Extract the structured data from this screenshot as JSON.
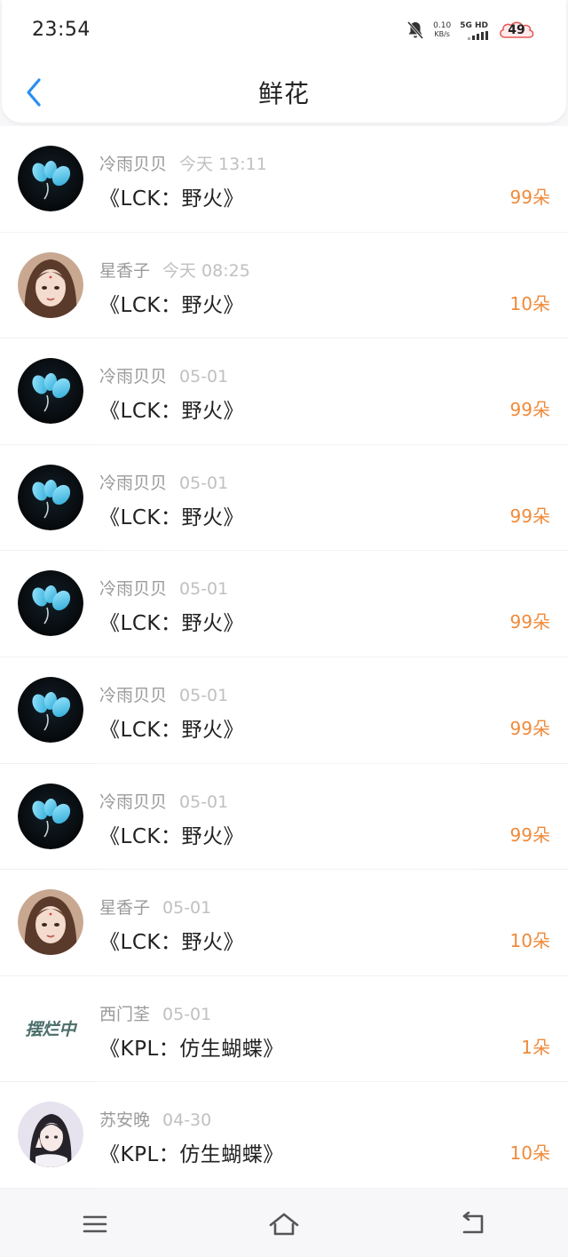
{
  "status_bar": {
    "time": "23:54",
    "net_speed_value": "0.10",
    "net_speed_unit": "KB/s",
    "network_label": "5G HD",
    "battery": "49"
  },
  "nav": {
    "title": "鲜花",
    "back_icon": "chevron-left-icon"
  },
  "colors": {
    "accent_blue": "#2a8ff0",
    "count_orange": "#f08a3a"
  },
  "items": [
    {
      "name": "冷雨贝贝",
      "date": "今天 13:11",
      "title": "《LCK：野火》",
      "count": "99朵",
      "avatar": "blue-butterfly"
    },
    {
      "name": "星香子",
      "date": "今天 08:25",
      "title": "《LCK：野火》",
      "count": "10朵",
      "avatar": "girl-portrait"
    },
    {
      "name": "冷雨贝贝",
      "date": "05-01",
      "title": "《LCK：野火》",
      "count": "99朵",
      "avatar": "blue-butterfly"
    },
    {
      "name": "冷雨贝贝",
      "date": "05-01",
      "title": "《LCK：野火》",
      "count": "99朵",
      "avatar": "blue-butterfly"
    },
    {
      "name": "冷雨贝贝",
      "date": "05-01",
      "title": "《LCK：野火》",
      "count": "99朵",
      "avatar": "blue-butterfly"
    },
    {
      "name": "冷雨贝贝",
      "date": "05-01",
      "title": "《LCK：野火》",
      "count": "99朵",
      "avatar": "blue-butterfly"
    },
    {
      "name": "冷雨贝贝",
      "date": "05-01",
      "title": "《LCK：野火》",
      "count": "99朵",
      "avatar": "blue-butterfly"
    },
    {
      "name": "星香子",
      "date": "05-01",
      "title": "《LCK：野火》",
      "count": "10朵",
      "avatar": "girl-portrait"
    },
    {
      "name": "西门荃",
      "date": "05-01",
      "title": "《KPL：仿生蝴蝶》",
      "count": "1朵",
      "avatar": "calligraphy",
      "avatar_text": "摆烂中"
    },
    {
      "name": "苏安晚",
      "date": "04-30",
      "title": "《KPL：仿生蝴蝶》",
      "count": "10朵",
      "avatar": "girl-photo"
    }
  ],
  "bottom_nav": {
    "icons": [
      "menu-icon",
      "home-icon",
      "back-icon"
    ]
  }
}
